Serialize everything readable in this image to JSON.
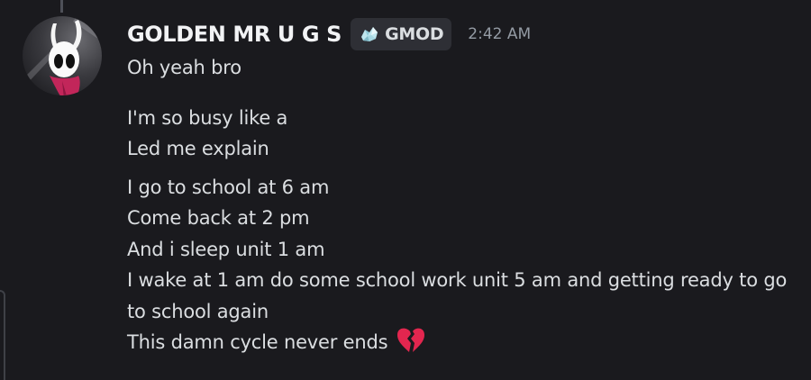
{
  "author": {
    "username": "GOLDEN MR U G S",
    "tag_label": "GMOD",
    "tag_icon": "crystal-sparkle-icon",
    "timestamp": "2:42 AM",
    "avatar_colors": {
      "background": "#2b2d31",
      "mask": "#ffffff",
      "cloak": "#c2265a"
    }
  },
  "messages": [
    {
      "text": "Oh yeah bro"
    },
    {
      "text": "I'm so busy like a"
    },
    {
      "text": "Led me explain"
    },
    {
      "text": "I go to school at 6 am"
    },
    {
      "text": "Come back at 2 pm"
    },
    {
      "text": "And i sleep unit 1 am"
    },
    {
      "text": "I wake at 1 am do some school work unit 5 am and getting ready to go to school again"
    },
    {
      "text": "This damn cycle never ends",
      "emoji": "broken-heart-icon"
    }
  ],
  "theme": {
    "background": "#1a1a1e",
    "text": "#dbdee1",
    "username": "#f2f3f5",
    "muted": "#949ba4",
    "tag_bg": "#2e2f35",
    "broken_heart": "#e3264f"
  }
}
